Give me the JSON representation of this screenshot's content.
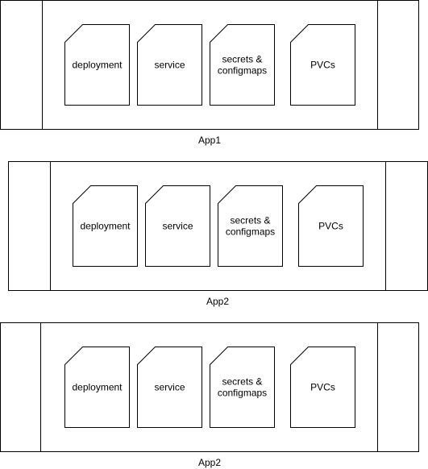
{
  "apps": [
    {
      "label": "App1",
      "resources": [
        {
          "lines": [
            "deployment"
          ]
        },
        {
          "lines": [
            "service"
          ]
        },
        {
          "lines": [
            "secrets &",
            "configmaps"
          ]
        },
        {
          "lines": [
            "PVCs"
          ]
        }
      ]
    },
    {
      "label": "App2",
      "resources": [
        {
          "lines": [
            "deployment"
          ]
        },
        {
          "lines": [
            "service"
          ]
        },
        {
          "lines": [
            "secrets &",
            "configmaps"
          ]
        },
        {
          "lines": [
            "PVCs"
          ]
        }
      ]
    },
    {
      "label": "App2",
      "resources": [
        {
          "lines": [
            "deployment"
          ]
        },
        {
          "lines": [
            "service"
          ]
        },
        {
          "lines": [
            "secrets &",
            "configmaps"
          ]
        },
        {
          "lines": [
            "PVCs"
          ]
        }
      ]
    }
  ],
  "colors": {
    "stroke": "#000000",
    "fill": "#ffffff",
    "text": "#000000"
  }
}
